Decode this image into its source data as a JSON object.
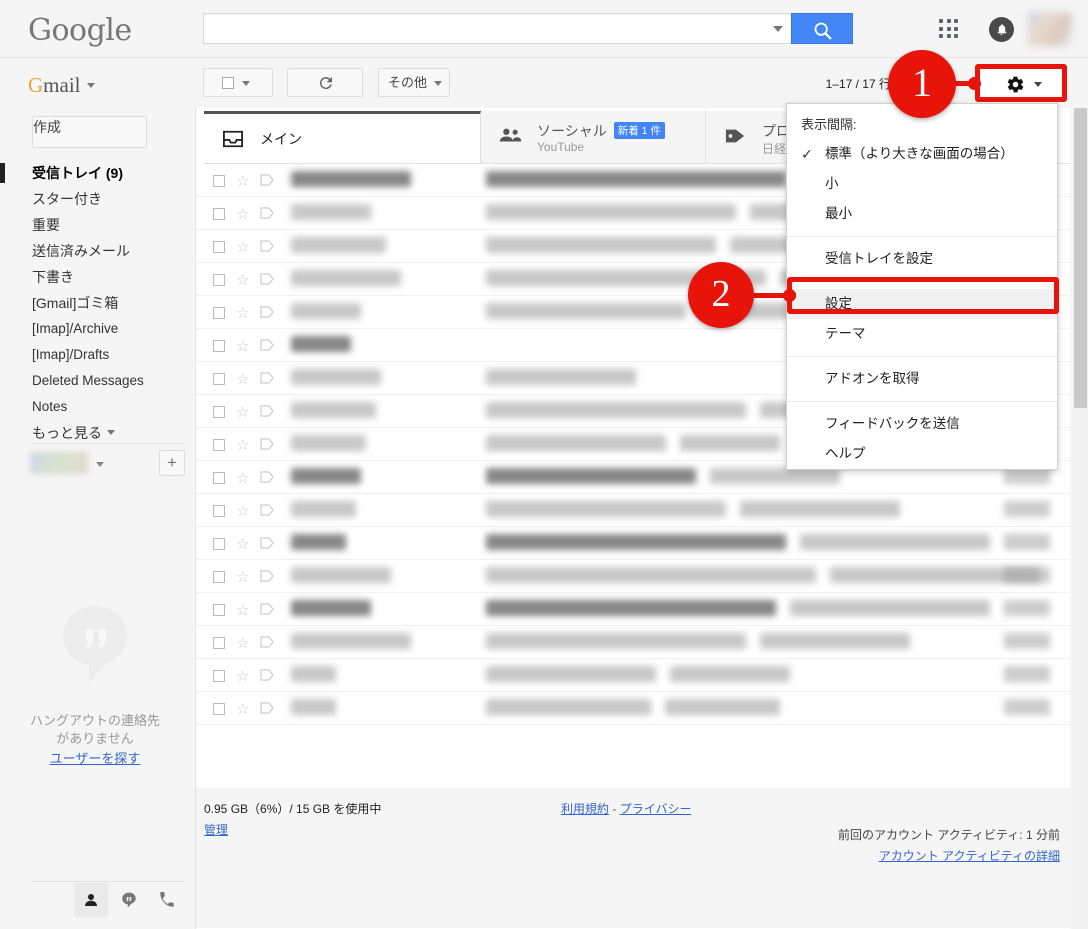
{
  "topbar": {
    "logo": "Google",
    "search_value": "",
    "search_placeholder": "",
    "search_icon": "search-icon",
    "apps_icon": "apps-grid-icon",
    "bell_icon": "notification-bell-icon",
    "avatar": "user-avatar"
  },
  "toolbar": {
    "product_label": "Gmail",
    "select_all_label": "",
    "refresh_label": "",
    "more_label": "その他",
    "range_text": "1–17 / 17 行",
    "gear_label": "",
    "prev_arrow": "‹",
    "next_arrow": "›"
  },
  "sidebar": {
    "compose_label": "作成",
    "items": [
      {
        "label": "受信トレイ (9)",
        "active": true
      },
      {
        "label": "スター付き",
        "active": false
      },
      {
        "label": "重要",
        "active": false
      },
      {
        "label": "送信済みメール",
        "active": false
      },
      {
        "label": "下書き",
        "active": false
      },
      {
        "label": "[Gmail]ゴミ箱",
        "active": false
      },
      {
        "label": "[Imap]/Archive",
        "active": false
      },
      {
        "label": "[Imap]/Drafts",
        "active": false
      },
      {
        "label": "Deleted Messages",
        "active": false
      },
      {
        "label": "Notes",
        "active": false
      },
      {
        "label": "もっと見る",
        "active": false
      }
    ],
    "add_contact_label": "+",
    "hangouts_empty_text": "ハングアウトの連絡先がありません",
    "hangouts_find_link": "ユーザーを探す",
    "hangouts_tabs": [
      "contacts-icon",
      "hangouts-icon",
      "phone-icon"
    ]
  },
  "tabs": [
    {
      "label": "メイン",
      "sub": "",
      "badge": "",
      "icon": "inbox-icon",
      "selected": true
    },
    {
      "label": "ソーシャル",
      "sub": "YouTube",
      "badge": "新着 1 件",
      "icon": "people-icon",
      "selected": false
    },
    {
      "label": "プロ",
      "sub": "日経：",
      "badge": "",
      "icon": "tag-icon",
      "selected": false
    }
  ],
  "mail_rows": [
    {
      "unread": true,
      "sender_w": 120,
      "subject_w": 300,
      "snippet_w": 180,
      "date_w": 46
    },
    {
      "unread": false,
      "sender_w": 80,
      "subject_w": 250,
      "snippet_w": 140,
      "date_w": 46
    },
    {
      "unread": false,
      "sender_w": 95,
      "subject_w": 230,
      "snippet_w": 120,
      "date_w": 46
    },
    {
      "unread": false,
      "sender_w": 110,
      "subject_w": 280,
      "snippet_w": 150,
      "date_w": 46
    },
    {
      "unread": false,
      "sender_w": 70,
      "subject_w": 200,
      "snippet_w": 110,
      "date_w": 46
    },
    {
      "unread": true,
      "sender_w": 60,
      "subject_w": 0,
      "snippet_w": 0,
      "date_w": 46
    },
    {
      "unread": false,
      "sender_w": 90,
      "subject_w": 150,
      "snippet_w": 0,
      "date_w": 46
    },
    {
      "unread": false,
      "sender_w": 85,
      "subject_w": 260,
      "snippet_w": 130,
      "date_w": 46
    },
    {
      "unread": false,
      "sender_w": 75,
      "subject_w": 180,
      "snippet_w": 100,
      "date_w": 46
    },
    {
      "unread": true,
      "sender_w": 70,
      "subject_w": 210,
      "snippet_w": 130,
      "date_w": 46
    },
    {
      "unread": false,
      "sender_w": 65,
      "subject_w": 240,
      "snippet_w": 160,
      "date_w": 46
    },
    {
      "unread": true,
      "sender_w": 55,
      "subject_w": 300,
      "snippet_w": 190,
      "date_w": 46
    },
    {
      "unread": false,
      "sender_w": 100,
      "subject_w": 330,
      "snippet_w": 210,
      "date_w": 46
    },
    {
      "unread": true,
      "sender_w": 80,
      "subject_w": 290,
      "snippet_w": 200,
      "date_w": 46
    },
    {
      "unread": false,
      "sender_w": 120,
      "subject_w": 260,
      "snippet_w": 150,
      "date_w": 46
    },
    {
      "unread": false,
      "sender_w": 45,
      "subject_w": 170,
      "snippet_w": 120,
      "date_w": 46
    },
    {
      "unread": false,
      "sender_w": 45,
      "subject_w": 165,
      "snippet_w": 115,
      "date_w": 46
    }
  ],
  "footer": {
    "storage_text": "0.95 GB（6%）/ 15 GB を使用中",
    "manage_label": "管理",
    "terms_label": "利用規約",
    "terms_sep": " - ",
    "privacy_label": "プライバシー",
    "activity_text": "前回のアカウント アクティビティ: 1 分前",
    "activity_detail_label": "アカウント アクティビティの詳細"
  },
  "settings_menu": {
    "header": "表示間隔:",
    "density_options": [
      {
        "label": "標準（より大きな画面の場合）",
        "checked": true
      },
      {
        "label": "小",
        "checked": false
      },
      {
        "label": "最小",
        "checked": false
      }
    ],
    "configure_inbox": "受信トレイを設定",
    "settings": "設定",
    "themes": "テーマ",
    "get_addons": "アドオンを取得",
    "send_feedback": "フィードバックを送信",
    "help": "ヘルプ"
  },
  "callouts": [
    {
      "number": "1",
      "target": "gear-settings-button"
    },
    {
      "number": "2",
      "target": "menu-item-settings"
    }
  ],
  "colors": {
    "accent_blue": "#4285f4",
    "callout_red": "#e8140a",
    "link_blue": "#3366cc",
    "chrome_gray": "#f5f5f5"
  }
}
